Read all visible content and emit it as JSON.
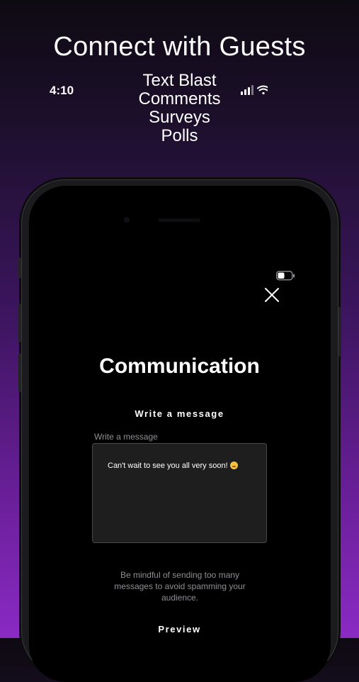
{
  "promo": {
    "title": "Connect with Guests",
    "features": [
      "Text Blast",
      "Comments",
      "Surveys",
      "Polls"
    ]
  },
  "status_bar": {
    "time": "4:10",
    "icons": [
      "signal-icon",
      "wifi-icon",
      "battery-icon"
    ]
  },
  "screen": {
    "title": "Communication",
    "write_heading": "Write a message",
    "field_placeholder": "Write a message",
    "message": "Can't wait to see you all very soon!",
    "message_emoji": "smiling-face-emoji",
    "hint": "Be mindful of sending too many messages to avoid spamming your audience.",
    "preview_heading": "Preview"
  },
  "colors": {
    "gradient_top": "#0e0a12",
    "gradient_bottom": "#8a2ac4",
    "screen_bg": "#000000",
    "input_bg": "#1e1e1f",
    "muted_text": "#8e8e93"
  }
}
